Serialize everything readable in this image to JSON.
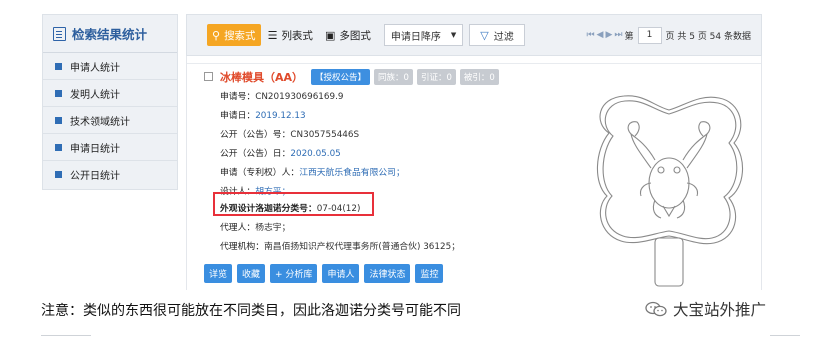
{
  "sidebar": {
    "title": "检索结果统计",
    "items": [
      {
        "label": "申请人统计"
      },
      {
        "label": "发明人统计"
      },
      {
        "label": "技术领域统计"
      },
      {
        "label": "申请日统计"
      },
      {
        "label": "公开日统计"
      }
    ]
  },
  "toolbar": {
    "view_search": "搜索式",
    "view_list": "列表式",
    "view_image": "多图式",
    "sort_value": "申请日降序",
    "filter_label": "过滤",
    "page_prefix": "第",
    "page_value": "1",
    "page_suffix": "页 共 5 页 54 条数据"
  },
  "result": {
    "title": "冰棒模具（AA）",
    "badge_status": "【授权公告】",
    "badge_same_family": "同族：0",
    "badge_cited": "引证：0",
    "badge_cited_by": "被引：0",
    "application_no": {
      "label": "申请号：",
      "value": "CN201930696169.9"
    },
    "application_date": {
      "label": "申请日：",
      "value": "2019.12.13"
    },
    "publication_no": {
      "label": "公开（公告）号：",
      "value": "CN305755446S"
    },
    "publication_date": {
      "label": "公开（公告）日：",
      "value": "2020.05.05"
    },
    "applicant": {
      "label": "申请（专利权）人：",
      "value": "江西天航乐食品有限公司；"
    },
    "designer": {
      "label": "设计人：",
      "value": "胡方平；"
    },
    "locarno": {
      "label": "外观设计洛迦诺分类号：",
      "value": "07-04(12)"
    },
    "agent": {
      "label": "代理人：",
      "value": "杨志宇；"
    },
    "agency": {
      "label": "代理机构：",
      "value": "南昌佰扬知识产权代理事务所(普通合伙) 36125；"
    },
    "actions": [
      "详览",
      "收藏",
      "+ 分析库",
      "申请人",
      "法律状态",
      "监控"
    ]
  },
  "note": "注意：类似的东西很可能放在不同类目，因此洛迦诺分类号可能不同",
  "watermark": "大宝站外推广",
  "colors": {
    "accent_orange": "#f5a623",
    "link_blue": "#2f6db5",
    "title_red": "#e04a2b",
    "highlight_red": "#e8303a",
    "action_blue": "#3a8ee0"
  }
}
